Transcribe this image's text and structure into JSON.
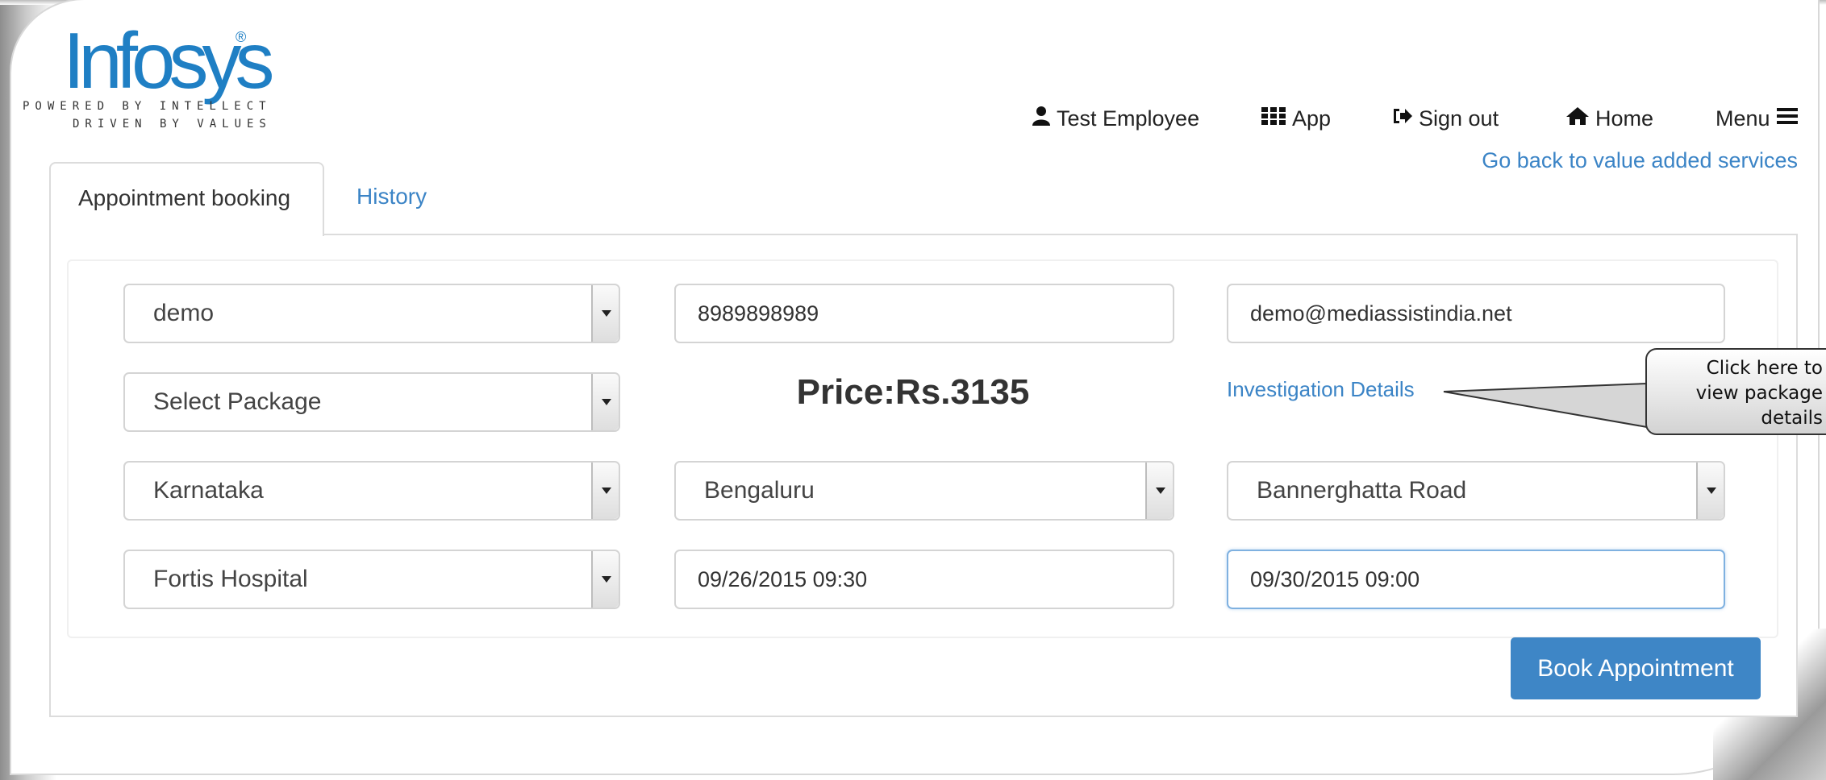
{
  "logo": {
    "word": "Infosys",
    "registered": "®",
    "tagline_line1": "POWERED BY INTELLECT",
    "tagline_line2": "DRIVEN BY VALUES"
  },
  "nav": {
    "user": "Test Employee",
    "app": "App",
    "sign_out": "Sign out",
    "home": "Home",
    "menu": "Menu",
    "go_back": "Go back to value added services"
  },
  "tabs": [
    {
      "label": "Appointment booking",
      "active": true
    },
    {
      "label": "History",
      "active": false
    }
  ],
  "form": {
    "patient_name": "demo",
    "mobile": "8989898989",
    "email": "demo@mediassistindia.net",
    "package": "Select Package",
    "price": "Price:Rs.3135",
    "investigation_link": "Investigation Details",
    "state": "Karnataka",
    "city": "Bengaluru",
    "locality": "Bannerghatta Road",
    "hospital": "Fortis Hospital",
    "date_1": "09/26/2015 09:30",
    "date_2": "09/30/2015 09:00",
    "book_button": "Book Appointment"
  },
  "callout": {
    "line1": "Click here to",
    "line2": "view package",
    "line3": "details"
  },
  "colors": {
    "link": "#3b84c6",
    "button": "#3e86c6",
    "logo": "#1f7fc4"
  }
}
